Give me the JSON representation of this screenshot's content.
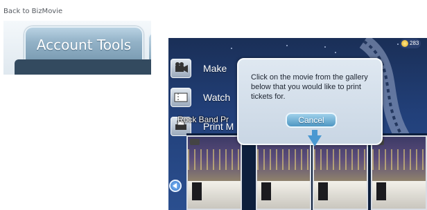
{
  "account": {
    "back_link": "Back to BizMovie",
    "tab_label": "Account Tools"
  },
  "game": {
    "coins": "283",
    "menu": [
      {
        "label": "Make",
        "icon": "camera-icon"
      },
      {
        "label": "Watch",
        "icon": "ticket-icon"
      },
      {
        "label": "Print M",
        "icon": "print-icon"
      }
    ],
    "gallery_title": "Rock Band Pr",
    "dialog": {
      "message": "Click on the movie from the gallery below that you would like to print tickets for.",
      "cancel_label": "Cancel"
    },
    "colors": {
      "accent": "#4a98d1",
      "night_sky": "#22407a"
    }
  }
}
